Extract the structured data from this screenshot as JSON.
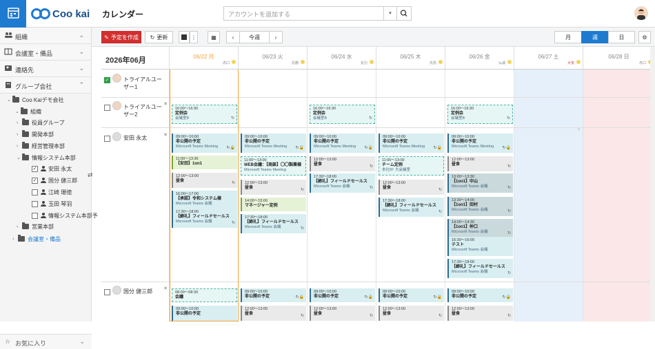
{
  "app": {
    "logo_text": "Coo kai",
    "title": "カレンダー",
    "accent": "#1e7bd0"
  },
  "search": {
    "placeholder": "アカウントを追加する"
  },
  "sidebar": {
    "sections": [
      {
        "label": "組織",
        "icon": "people-icon"
      },
      {
        "label": "会議室・備品",
        "icon": "room-icon"
      },
      {
        "label": "連絡先",
        "icon": "contacts-icon"
      },
      {
        "label": "グループ会社",
        "icon": "building-icon"
      }
    ],
    "tree": [
      "Coo Kaiデモ会社",
      "組織",
      "役員グループ",
      "開発本部",
      "経営管理本部",
      "情報システム本部",
      "安田 永太",
      "国分 健三郎",
      "江崎 珊徳",
      "玉田 琴羽",
      "情報システム本部予",
      "営業本部",
      "会議室・備品"
    ],
    "favorites": "お気に入り"
  },
  "toolbar": {
    "create": "予定を作成",
    "refresh": "更新",
    "this_week": "今週",
    "month": "月",
    "week": "週",
    "day": "日"
  },
  "calendar": {
    "month_label": "2026年06月",
    "days": [
      {
        "date": "06/22 月",
        "rokuyo": "赤口"
      },
      {
        "date": "06/23 火",
        "rokuyo": "先勝"
      },
      {
        "date": "06/24 水",
        "rokuyo": "友引"
      },
      {
        "date": "06/25 木",
        "rokuyo": "先負"
      },
      {
        "date": "06/26 金",
        "rokuyo": "仏滅"
      },
      {
        "date": "06/27 土",
        "rokuyo": "大安"
      },
      {
        "date": "06/28 日",
        "rokuyo": "赤口"
      }
    ],
    "members": [
      {
        "name": "トライアルユーザー1"
      },
      {
        "name": "トライアルユーザー2"
      },
      {
        "name": "安田 永太"
      },
      {
        "name": "国分 健三郎"
      }
    ],
    "events": {
      "u2_wed": {
        "time": "16:00～16:30",
        "title": "定例会",
        "sub": "会議室B"
      },
      "u2_mon": {
        "time": "16:00～16:30",
        "title": "定例会",
        "sub": "会議室B"
      },
      "u2_fri": {
        "time": "16:00～16:30",
        "title": "定例会",
        "sub": "会議室B"
      },
      "y_mon1": {
        "time": "09:00～10:00",
        "title": "非公開の予定",
        "sub": "Microsoft Teams Meeting"
      },
      "y_mon2": {
        "time": "11:00～13:30",
        "title": "【安田】1on1",
        "sub": ""
      },
      "y_mon3": {
        "time": "12:00～13:00",
        "title": "昼食",
        "sub": ""
      },
      "y_mon4": {
        "time": "16:00～17:00",
        "title": "【承認】令和システム様",
        "sub": "Microsoft Teams 会議"
      },
      "y_mon5": {
        "time": "17:30～18:00",
        "title": "【締礼】フィールドセールス",
        "sub": "Microsoft Teams 会議"
      },
      "y_tue1": {
        "time": "09:00～10:00",
        "title": "非公開の予定",
        "sub": "Microsoft Teams Meeting"
      },
      "y_tue2": {
        "time": "11:00～13:00",
        "title": "WEB会議：【商談】〇〇製薬様",
        "sub": "Microsoft Teams Meeting"
      },
      "y_tue3": {
        "time": "12:00～13:00",
        "title": "昼食",
        "sub": ""
      },
      "y_tue4": {
        "time": "14:00～15:00",
        "title": "マネージャー定例",
        "sub": ""
      },
      "y_tue5": {
        "time": "17:30～18:00",
        "title": "【締礼】フィールドセールス",
        "sub": "Microsoft Teams 会議"
      },
      "y_wed1": {
        "time": "09:00～10:00",
        "title": "非公開の予定",
        "sub": "Microsoft Teams Meeting"
      },
      "y_wed2": {
        "time": "12:00～13:00",
        "title": "昼食",
        "sub": ""
      },
      "y_wed3": {
        "time": "17:30～18:00",
        "title": "【締礼】フィールドセールス",
        "sub": "Microsoft Teams 会議"
      },
      "y_thu1": {
        "time": "09:00～10:00",
        "title": "非公開の予定",
        "sub": "Microsoft Teams Meeting"
      },
      "y_thu2": {
        "time": "11:00～13:00",
        "title": "チーム定例",
        "sub": "本社5F 大会議室"
      },
      "y_thu3": {
        "time": "12:00～13:00",
        "title": "昼食",
        "sub": ""
      },
      "y_thu4": {
        "time": "17:30～18:00",
        "title": "【締礼】フィールドセールス",
        "sub": "Microsoft Teams 会議"
      },
      "y_fri1": {
        "time": "09:00～10:00",
        "title": "非公開の予定",
        "sub": "Microsoft Teams Meeting"
      },
      "y_fri2": {
        "time": "12:00～13:00",
        "title": "昼食",
        "sub": ""
      },
      "y_fri3": {
        "time": "13:00～13:30",
        "title": "【1on1】中山",
        "sub": "Microsoft Teams 会議"
      },
      "y_fri4": {
        "time": "13:30～14:00",
        "title": "【1on1】田村",
        "sub": "Microsoft Teams 会議"
      },
      "y_fri5": {
        "time": "14:00～14:30",
        "title": "【1on1】仲口",
        "sub": "Microsoft Teams 会議"
      },
      "y_fri6": {
        "time": "15:30～16:00",
        "title": "テスト",
        "sub": "Microsoft Teams 会議"
      },
      "y_fri7": {
        "time": "17:30～18:00",
        "title": "【締礼】フィールドセールス",
        "sub": "Microsoft Teams 会議"
      },
      "k_mon1": {
        "time": "08:00～08:30",
        "title": "会議",
        "sub": ""
      },
      "k_mon2": {
        "time": "09:00～10:00",
        "title": "非公開の予定",
        "sub": ""
      },
      "k_tue1": {
        "time": "09:00～10:00",
        "title": "非公開の予定",
        "sub": ""
      },
      "k_tue2": {
        "time": "12:00～13:00",
        "title": "昼食",
        "sub": ""
      },
      "k_wed1": {
        "time": "09:00～10:00",
        "title": "非公開の予定",
        "sub": ""
      },
      "k_wed2": {
        "time": "12:00～13:00",
        "title": "昼食",
        "sub": ""
      },
      "k_thu1": {
        "time": "09:00～10:00",
        "title": "非公開の予定",
        "sub": ""
      },
      "k_thu2": {
        "time": "12:00～13:00",
        "title": "昼食",
        "sub": ""
      },
      "k_fri1": {
        "time": "09:00～10:00",
        "title": "非公開の予定",
        "sub": ""
      },
      "k_fri2": {
        "time": "12:00～13:00",
        "title": "昼食",
        "sub": ""
      }
    }
  }
}
